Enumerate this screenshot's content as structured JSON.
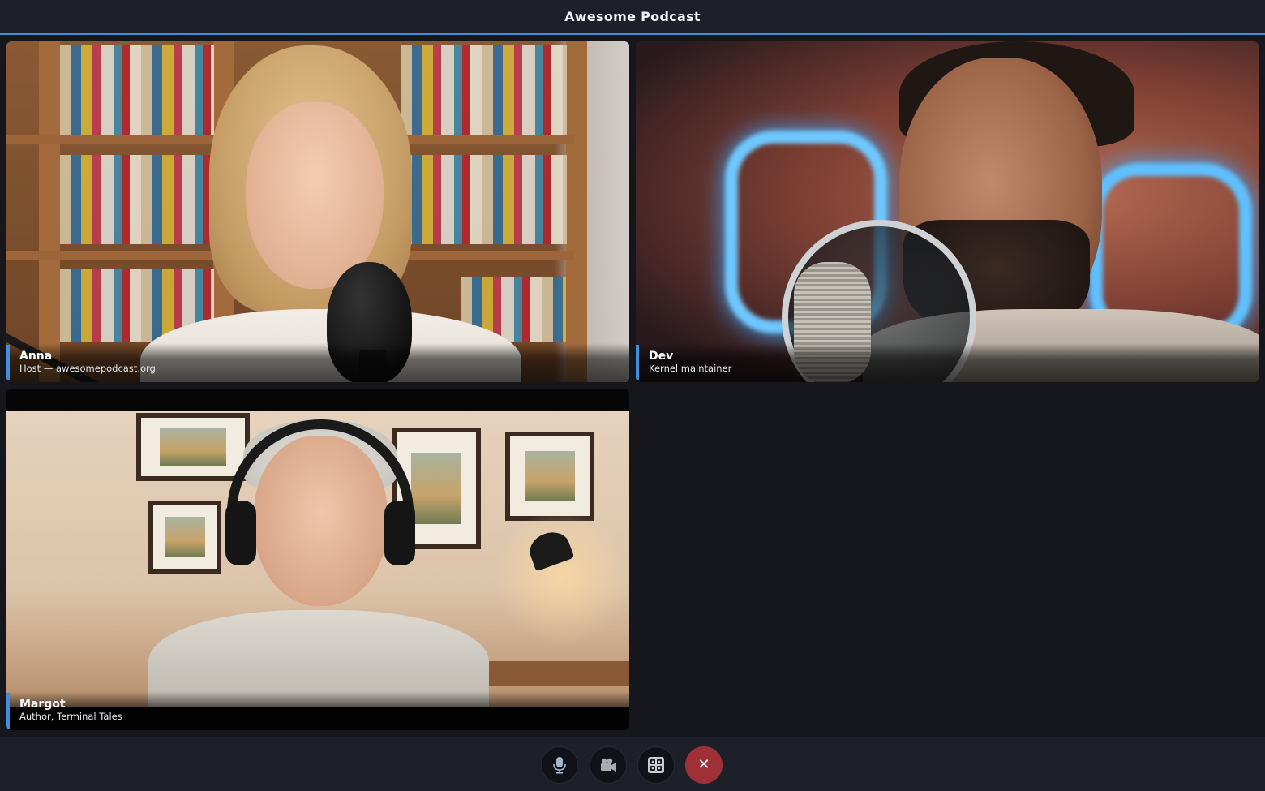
{
  "app": {
    "title": "Awesome Podcast"
  },
  "participants": [
    {
      "name": "Anna",
      "subtitle": "Host — awesomepodcast.org"
    },
    {
      "name": "Dev",
      "subtitle": "Kernel maintainer"
    },
    {
      "name": "Margot",
      "subtitle": "Author, Terminal Tales"
    }
  ],
  "controls": [
    {
      "icon": "microphone-icon"
    },
    {
      "icon": "video-camera-icon"
    },
    {
      "icon": "layout-grid-icon"
    },
    {
      "icon": "close-icon",
      "label": "✕"
    }
  ],
  "colors": {
    "accent": "#3e8fe0",
    "hangup": "#a03038",
    "background": "#15171c",
    "bar": "#1d2029"
  }
}
